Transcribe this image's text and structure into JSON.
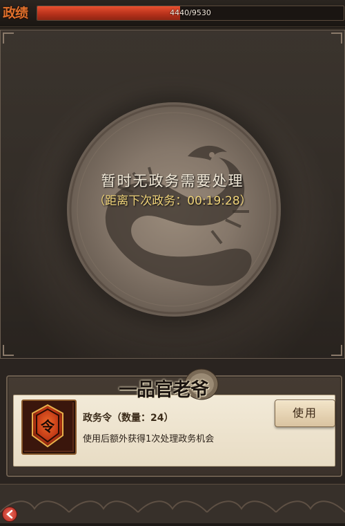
{
  "header": {
    "title": "政绩",
    "progress_text": "4440/9530",
    "progress_current": 4440,
    "progress_max": 9530
  },
  "main": {
    "status_text": "暂时无政务需要处理",
    "countdown_text": "（距离下次政务：00:19:28）"
  },
  "game_logo": {
    "text": "一品官老爷"
  },
  "item": {
    "name": "政务令（数量：24）",
    "description": "使用后额外获得1次处理政务机会",
    "use_label": "使用",
    "icon_glyph": "令"
  },
  "colors": {
    "progress_fill": "#c93a1f",
    "title_accent": "#e1712c",
    "countdown": "#efd37a",
    "card_bg": "#efe5d0"
  },
  "icons": [
    "dragon-emblem-icon",
    "token-icon",
    "back-arrow-icon"
  ]
}
